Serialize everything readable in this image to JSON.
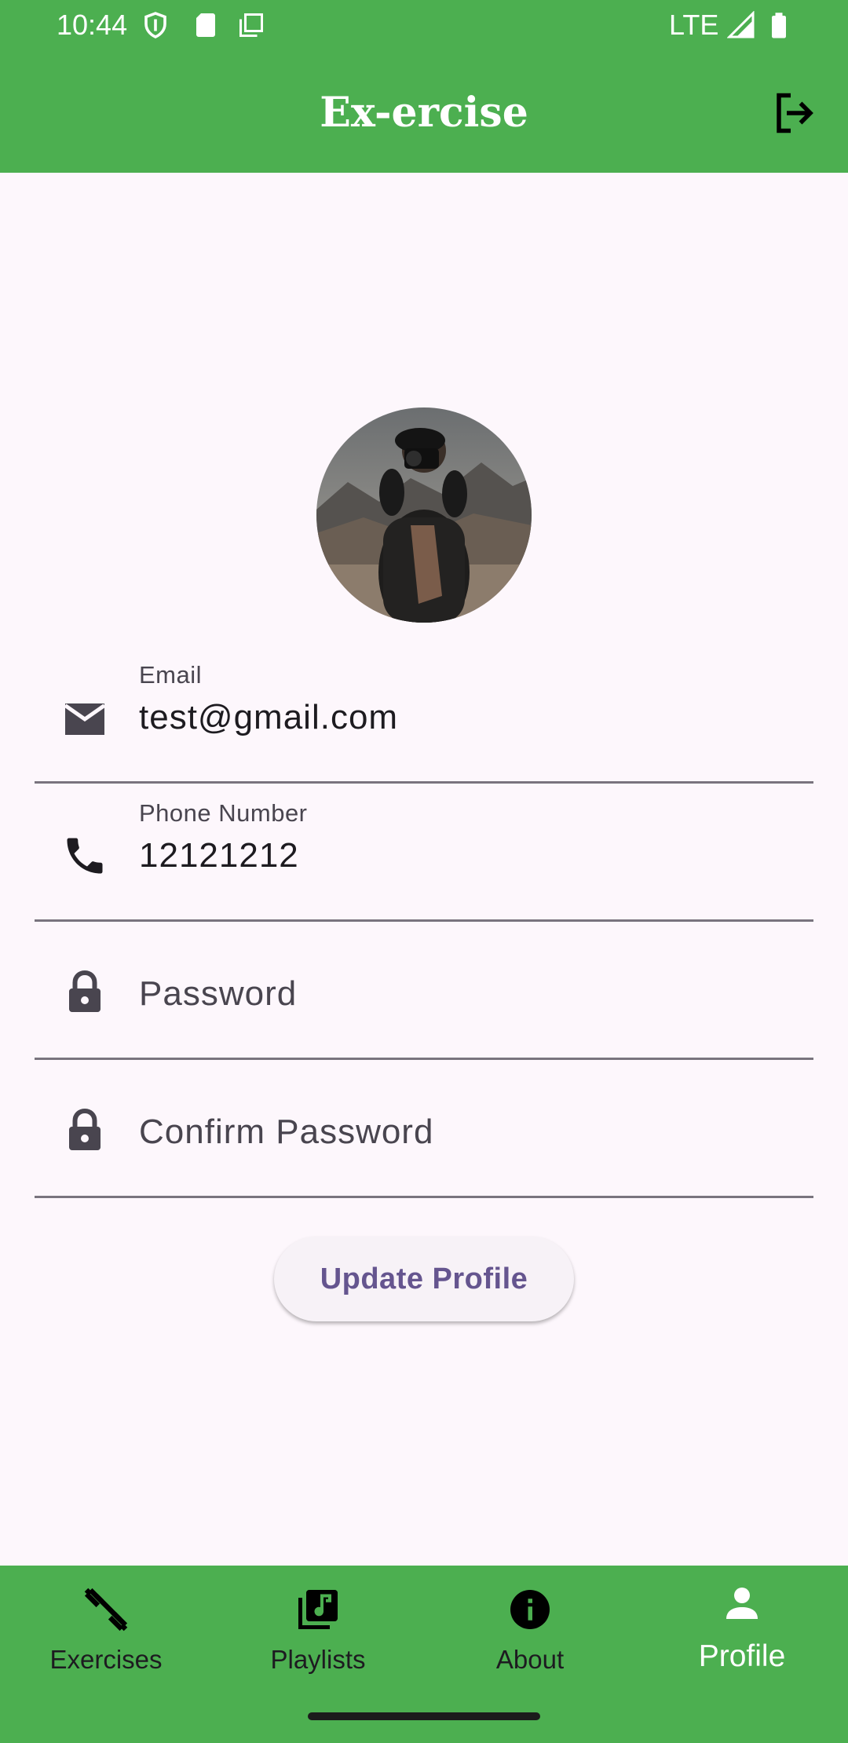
{
  "status_bar": {
    "time": "10:44",
    "network": "LTE"
  },
  "app_bar": {
    "title": "Ex-ercise",
    "action_icon": "logout-icon"
  },
  "profile": {
    "avatar_description": "photographer-avatar",
    "fields": [
      {
        "label": "Email",
        "value": "test@gmail.com",
        "icon": "email-icon"
      },
      {
        "label": "Phone Number",
        "value": "12121212",
        "icon": "phone-icon"
      },
      {
        "placeholder": "Password",
        "value": "",
        "icon": "lock-icon"
      },
      {
        "placeholder": "Confirm Password",
        "value": "",
        "icon": "lock-icon"
      }
    ],
    "update_button": "Update Profile"
  },
  "bottom_nav": {
    "items": [
      {
        "label": "Exercises",
        "icon": "dumbbell-icon",
        "active": false
      },
      {
        "label": "Playlists",
        "icon": "music-library-icon",
        "active": false
      },
      {
        "label": "About",
        "icon": "info-icon",
        "active": false
      },
      {
        "label": "Profile",
        "icon": "person-icon",
        "active": true
      }
    ]
  },
  "colors": {
    "app_bar": "#4caf50",
    "background": "#fdf7fc",
    "button_text": "#65558f",
    "field_underline": "#79747e"
  }
}
